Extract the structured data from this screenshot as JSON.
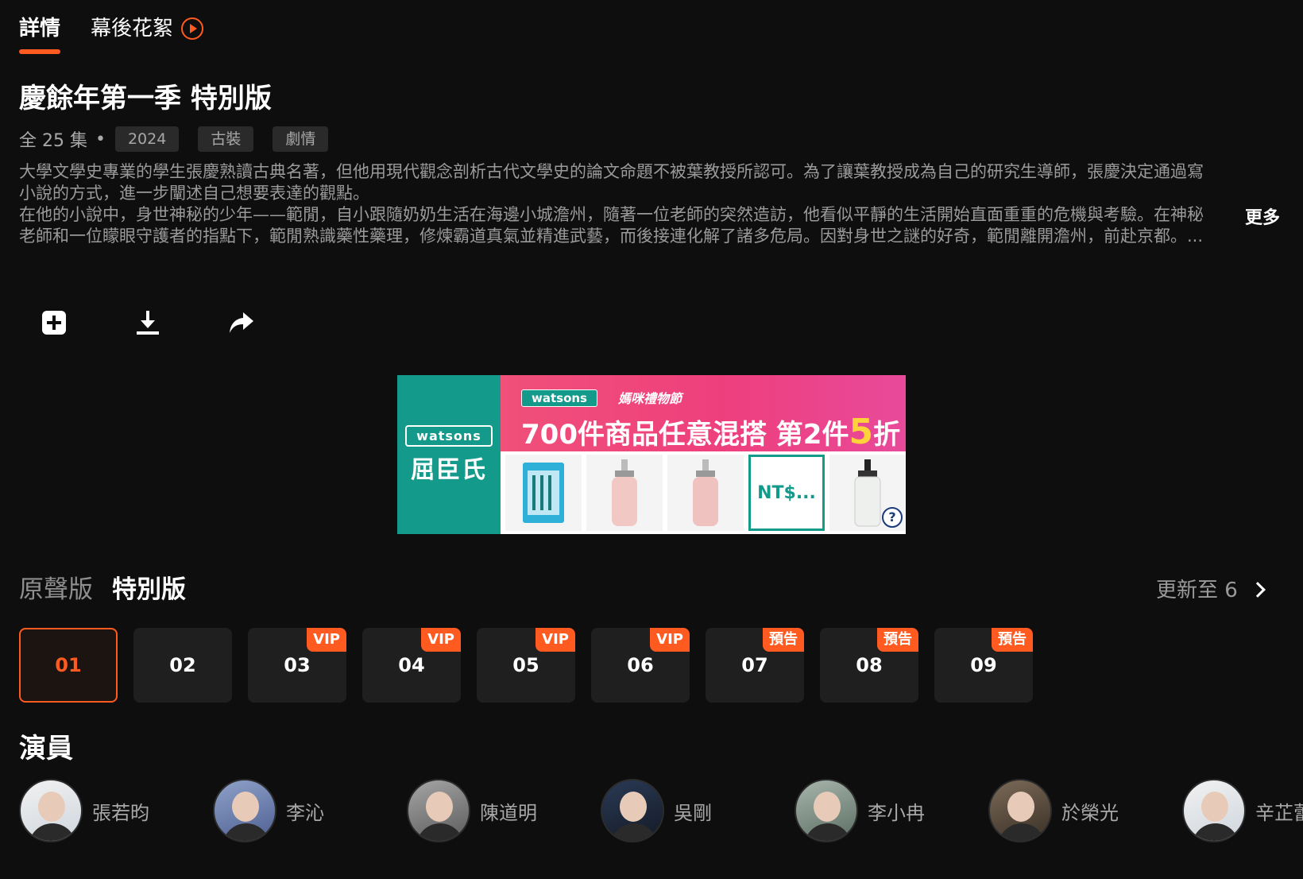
{
  "tabs": [
    {
      "label": "詳情"
    },
    {
      "label": "幕後花絮"
    }
  ],
  "show": {
    "title": "慶餘年第一季 特別版",
    "episodes_label": "全 25 集",
    "tags": [
      "2024",
      "古裝",
      "劇情"
    ]
  },
  "synopsis": {
    "paragraph1": "大學文學史專業的學生張慶熟讀古典名著，但他用現代觀念剖析古代文學史的論文命題不被葉教授所認可。為了讓葉教授成為自己的研究生導師，張慶決定通過寫小說的方式，進一步闡述自己想要表達的觀點。",
    "paragraph2": "在他的小說中，身世神秘的少年——範閒，自小跟隨奶奶生活在海邊小城澹州，隨著一位老師的突然造訪，他看似平靜的生活開始直面重重的危機與考驗。在神秘老師和一位矇眼守護者的指點下，範閒熟識藥性藥理，修煉霸道真氣並精進武藝，而後接連化解了諸多危局。因對身世之謎的好奇，範閒離開澹州，前赴京都。...",
    "more_label": "更多"
  },
  "actions": [
    {
      "icon": "add-square-icon"
    },
    {
      "icon": "download-icon"
    },
    {
      "icon": "share-icon"
    }
  ],
  "ad": {
    "logo_en": "watsons",
    "logo_cn": "屈臣氏",
    "brand": "watsons",
    "subtitle": "媽咪禮物節",
    "headline_pre": "700件商品任意混搭 第2件",
    "headline_num": "5",
    "headline_post": "折",
    "price": "NT$...",
    "help": "?"
  },
  "versions": [
    {
      "label": "原聲版"
    },
    {
      "label": "特別版"
    }
  ],
  "update_label": "更新至 6",
  "episodes": [
    {
      "num": "01",
      "badge": ""
    },
    {
      "num": "02",
      "badge": ""
    },
    {
      "num": "03",
      "badge": "VIP"
    },
    {
      "num": "04",
      "badge": "VIP"
    },
    {
      "num": "05",
      "badge": "VIP"
    },
    {
      "num": "06",
      "badge": "VIP"
    },
    {
      "num": "07",
      "badge": "預告"
    },
    {
      "num": "08",
      "badge": "預告"
    },
    {
      "num": "09",
      "badge": "預告"
    }
  ],
  "cast_title": "演員",
  "cast": [
    {
      "name": "張若昀"
    },
    {
      "name": "李沁"
    },
    {
      "name": "陳道明"
    },
    {
      "name": "吳剛"
    },
    {
      "name": "李小冉"
    },
    {
      "name": "於榮光"
    },
    {
      "name": "辛芷蕾"
    }
  ],
  "colors": {
    "accent": "#ff5a1f",
    "background": "#0e0e0e",
    "ad_teal": "#139a8b",
    "ad_pink": "#ee3f7d"
  }
}
